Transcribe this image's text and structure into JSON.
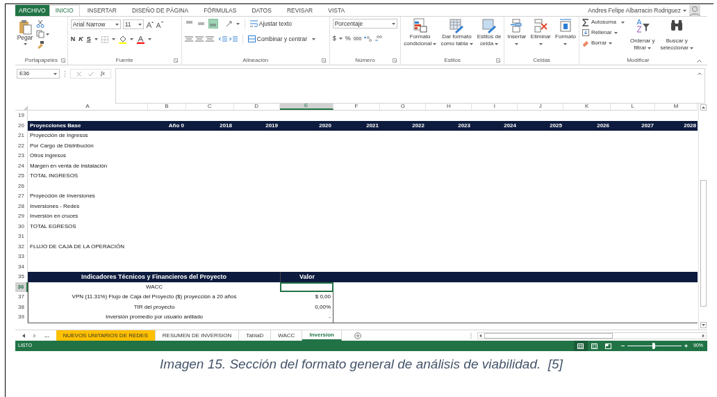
{
  "ribbon_tabs": [
    {
      "label": "ARCHIVO",
      "kind": "file",
      "selected": false
    },
    {
      "label": "INICIO",
      "kind": "tab",
      "selected": true
    },
    {
      "label": "INSERTAR",
      "kind": "tab",
      "selected": false
    },
    {
      "label": "DISEÑO DE PÁGINA",
      "kind": "tab",
      "selected": false
    },
    {
      "label": "FÓRMULAS",
      "kind": "tab",
      "selected": false
    },
    {
      "label": "DATOS",
      "kind": "tab",
      "selected": false
    },
    {
      "label": "REVISAR",
      "kind": "tab",
      "selected": false
    },
    {
      "label": "VISTA",
      "kind": "tab",
      "selected": false
    }
  ],
  "user": "Andres Felipe Albarracin Rodriguez",
  "clipboard": {
    "paste": "Pegar",
    "label": "Portapapeles"
  },
  "font": {
    "name": "Arial Narrow",
    "size": "11",
    "bold": "N",
    "italic": "K",
    "underline": "S",
    "label": "Fuente"
  },
  "alignment": {
    "vertical_align": [
      {
        "selected": false
      },
      {
        "selected": false
      },
      {
        "selected": true
      }
    ],
    "wrap": "Ajustar texto",
    "merge": "Combinar y centrar",
    "label": "Alineación"
  },
  "number": {
    "format": "Porcentaje",
    "currency": "$",
    "percent": "%",
    "thousands": "000",
    "label": "Número"
  },
  "styles": {
    "label": "Estilos",
    "buttons": [
      {
        "kind": "conditional",
        "lines": [
          "Formato",
          "condicional"
        ]
      },
      {
        "kind": "table",
        "lines": [
          "Dar formato",
          "como tabla"
        ]
      },
      {
        "kind": "cell",
        "lines": [
          "Estilos de",
          "celda"
        ]
      }
    ]
  },
  "cells": {
    "label": "Celdas",
    "buttons": [
      {
        "kind": "insert",
        "label": "Insertar"
      },
      {
        "kind": "delete",
        "label": "Eliminar"
      },
      {
        "kind": "format",
        "label": "Formato"
      }
    ]
  },
  "editing": {
    "autosum": "Autosuma",
    "fill": "Rellenar",
    "clear": "Borrar",
    "sort": [
      "Ordenar y",
      "filtrar"
    ],
    "find": [
      "Buscar y",
      "seleccionar"
    ],
    "label": "Modificar"
  },
  "name_box": "E36",
  "function_label": "fx",
  "columns": [
    {
      "label": "A",
      "selected": false
    },
    {
      "label": "B",
      "selected": false
    },
    {
      "label": "C",
      "selected": false
    },
    {
      "label": "D",
      "selected": false
    },
    {
      "label": "E",
      "selected": true
    },
    {
      "label": "F",
      "selected": false
    },
    {
      "label": "G",
      "selected": false
    },
    {
      "label": "H",
      "selected": false
    },
    {
      "label": "I",
      "selected": false
    },
    {
      "label": "J",
      "selected": false
    },
    {
      "label": "K",
      "selected": false
    },
    {
      "label": "L",
      "selected": false
    },
    {
      "label": "M",
      "selected": false
    }
  ],
  "rows": [
    {
      "number": "19",
      "kind": "blank",
      "selected": false
    },
    {
      "number": "20",
      "kind": "band",
      "selected": false,
      "cells": [
        "Proyecciones Base",
        "Año 0",
        "2018",
        "2019",
        "2020",
        "2021",
        "2022",
        "2023",
        "2024",
        "2025",
        "2026",
        "2027",
        "2028"
      ]
    },
    {
      "number": "21",
      "kind": "text",
      "selected": false,
      "text": "Proyección de Ingresos"
    },
    {
      "number": "22",
      "kind": "text",
      "selected": false,
      "text": "Por Cargo de Distribución"
    },
    {
      "number": "23",
      "kind": "text",
      "selected": false,
      "text": "Otros ingresos"
    },
    {
      "number": "24",
      "kind": "text",
      "selected": false,
      "text": "Margen en venta de instalación"
    },
    {
      "number": "25",
      "kind": "text",
      "selected": false,
      "text": "TOTAL INGRESOS"
    },
    {
      "number": "26",
      "kind": "blank",
      "selected": false
    },
    {
      "number": "27",
      "kind": "text",
      "selected": false,
      "text": "Proyección de Inversiones"
    },
    {
      "number": "28",
      "kind": "text",
      "selected": false,
      "text": "Inversiones - Redes"
    },
    {
      "number": "29",
      "kind": "text",
      "selected": false,
      "text": "Inversión en cruces"
    },
    {
      "number": "30",
      "kind": "text",
      "selected": false,
      "text": "TOTAL EGRESOS"
    },
    {
      "number": "31",
      "kind": "blank",
      "selected": false
    },
    {
      "number": "32",
      "kind": "text",
      "selected": false,
      "text": "FLUJO DE CAJA DE LA OPERACIÓN"
    },
    {
      "number": "33",
      "kind": "blank",
      "selected": false
    },
    {
      "number": "34",
      "kind": "blank",
      "selected": false
    },
    {
      "number": "35",
      "kind": "table_header",
      "selected": false,
      "label": "Indicadores Técnicos y Financieros del Proyecto",
      "value": "Valor"
    },
    {
      "number": "36",
      "kind": "table_row",
      "selected": true,
      "label": "WACC"
    },
    {
      "number": "37",
      "kind": "table_row",
      "selected": false,
      "label": "VPN (11.31%) Flujo de Caja del Proyecto ($) proyección a 20 años",
      "value": "$ 0,00"
    },
    {
      "number": "38",
      "kind": "table_row",
      "selected": false,
      "label": "TIR del proyecto",
      "value": "0,00%"
    },
    {
      "number": "39",
      "kind": "table_row",
      "selected": false,
      "label": "Inversión promedio por usuario anillado",
      "value": "-"
    }
  ],
  "sheet_tabs_more": "...",
  "sheet_tabs": [
    {
      "label": "NUEVOS UNITARIOS DE REDES",
      "color": "#ffc000",
      "selected": false
    },
    {
      "label": "RESUMEN DE INVERSION",
      "selected": false
    },
    {
      "label": "TablaD",
      "selected": false
    },
    {
      "label": "WACC",
      "selected": false
    },
    {
      "label": "Inversion",
      "selected": true
    }
  ],
  "status_bar": {
    "status": "LISTO",
    "views": [
      {
        "kind": "normal",
        "selected": true
      },
      {
        "kind": "layout",
        "selected": false
      },
      {
        "kind": "break",
        "selected": false
      }
    ],
    "zoom": {
      "level": 0.46,
      "reading": "90%"
    }
  },
  "caption": "Imagen 15. Sección del formato general de análisis de viabilidad.  [5]"
}
